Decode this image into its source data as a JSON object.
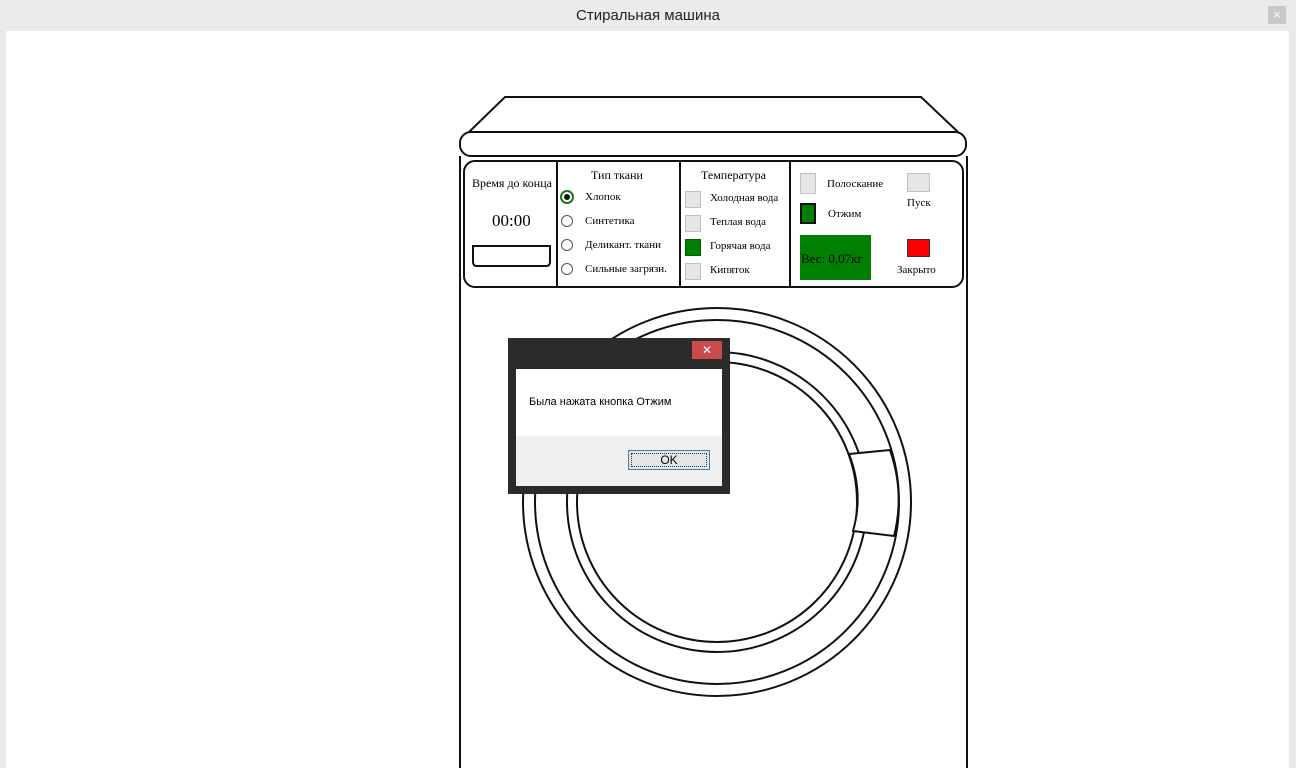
{
  "window": {
    "title": "Стиральная машина",
    "close_glyph": "×"
  },
  "panel": {
    "time_section": {
      "title": "Время до конца",
      "value": "00:00"
    },
    "fabric_section": {
      "title": "Тип ткани",
      "options": [
        "Хлопок",
        "Синтетика",
        "Деликант. ткани",
        "Сильные загрязн."
      ],
      "selected": "Хлопок"
    },
    "temperature_section": {
      "title": "Температура",
      "options": [
        "Холодная вода",
        "Теплая вода",
        "Горячая вода",
        "Кипяток"
      ],
      "active": "Горячая вода"
    },
    "controls": {
      "rinse_label": "Полоскание",
      "spin_label": "Отжим",
      "start_label": "Пуск",
      "weight_label": "Вес: 0,07кг",
      "door_label": "Закрыто",
      "spin_active": true
    }
  },
  "dialog": {
    "message": "Была нажата кнопка Отжим",
    "ok_label": "OK",
    "close_glyph": "✕"
  },
  "colors": {
    "active_green": "#008000",
    "door_red": "#ff0000",
    "dialog_frame": "#2b2b2b",
    "dialog_close": "#c94b4b"
  }
}
